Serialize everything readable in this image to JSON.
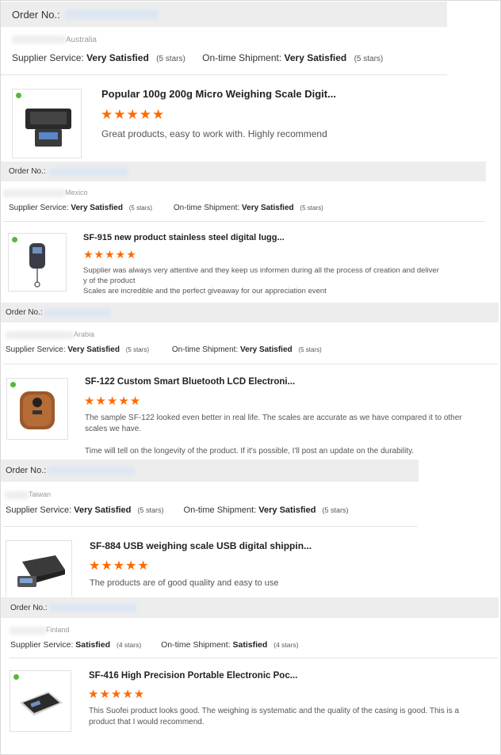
{
  "order_label": "Order No.:",
  "review_1": {
    "country": "Australia",
    "service_label": "Supplier Service:",
    "service_value": "Very Satisfied",
    "service_stars": "(5 stars)",
    "shipment_label": "On-time Shipment:",
    "shipment_value": "Very Satisfied",
    "shipment_stars": "(5 stars)",
    "product_title": "Popular 100g 200g Micro Weighing Scale Digit...",
    "rating": "★★★★★",
    "comment": "Great products, easy to work with. Highly recommend"
  },
  "review_2": {
    "country": "Mexico",
    "service_label": "Supplier Service:",
    "service_value": "Very Satisfied",
    "service_stars": "(5 stars)",
    "shipment_label": "On-time Shipment:",
    "shipment_value": "Very Satisfied",
    "shipment_stars": "(5 stars)",
    "product_title": "SF-915 new product stainless steel digital lugg...",
    "rating": "★★★★★",
    "comment_1": "Supplier was always very attentive and they keep us informen during all the process of creation and deliver",
    "comment_2": "y of the product",
    "comment_3": "Scales are incredible and the perfect giveaway for our appreciation event"
  },
  "review_3": {
    "country": "Arabia",
    "service_label": "Supplier Service:",
    "service_value": "Very Satisfied",
    "service_stars": "(5 stars)",
    "shipment_label": "On-time Shipment:",
    "shipment_value": "Very Satisfied",
    "shipment_stars": "(5 stars)",
    "product_title": "SF-122 Custom Smart Bluetooth LCD Electroni...",
    "rating": "★★★★★",
    "comment_1": "The sample SF-122 looked even better in real life. The scales are accurate as we have compared it to other",
    "comment_2": "scales we have.",
    "comment_3": "Time will tell on the longevity of the product. If it's possible, I'll post an update on the durability."
  },
  "review_4": {
    "country": "Taiwan",
    "service_label": "Supplier Service:",
    "service_value": "Very Satisfied",
    "service_stars": "(5 stars)",
    "shipment_label": "On-time Shipment:",
    "shipment_value": "Very Satisfied",
    "shipment_stars": "(5 stars)",
    "product_title": "SF-884 USB weighing scale USB digital shippin...",
    "rating": "★★★★★",
    "comment": "The products are of good quality and easy to use"
  },
  "review_5": {
    "country": "Finland",
    "service_label": "Supplier Service:",
    "service_value": "Satisfied",
    "service_stars": "(4 stars)",
    "shipment_label": "On-time Shipment:",
    "shipment_value": "Satisfied",
    "shipment_stars": "(4 stars)",
    "product_title": "SF-416 High Precision Portable Electronic Poc...",
    "rating": "★★★★★",
    "comment_1": "This Suofei product looks good. The weighing is systematic and the quality of the casing is good. This is a",
    "comment_2": "product that I would recommend."
  }
}
